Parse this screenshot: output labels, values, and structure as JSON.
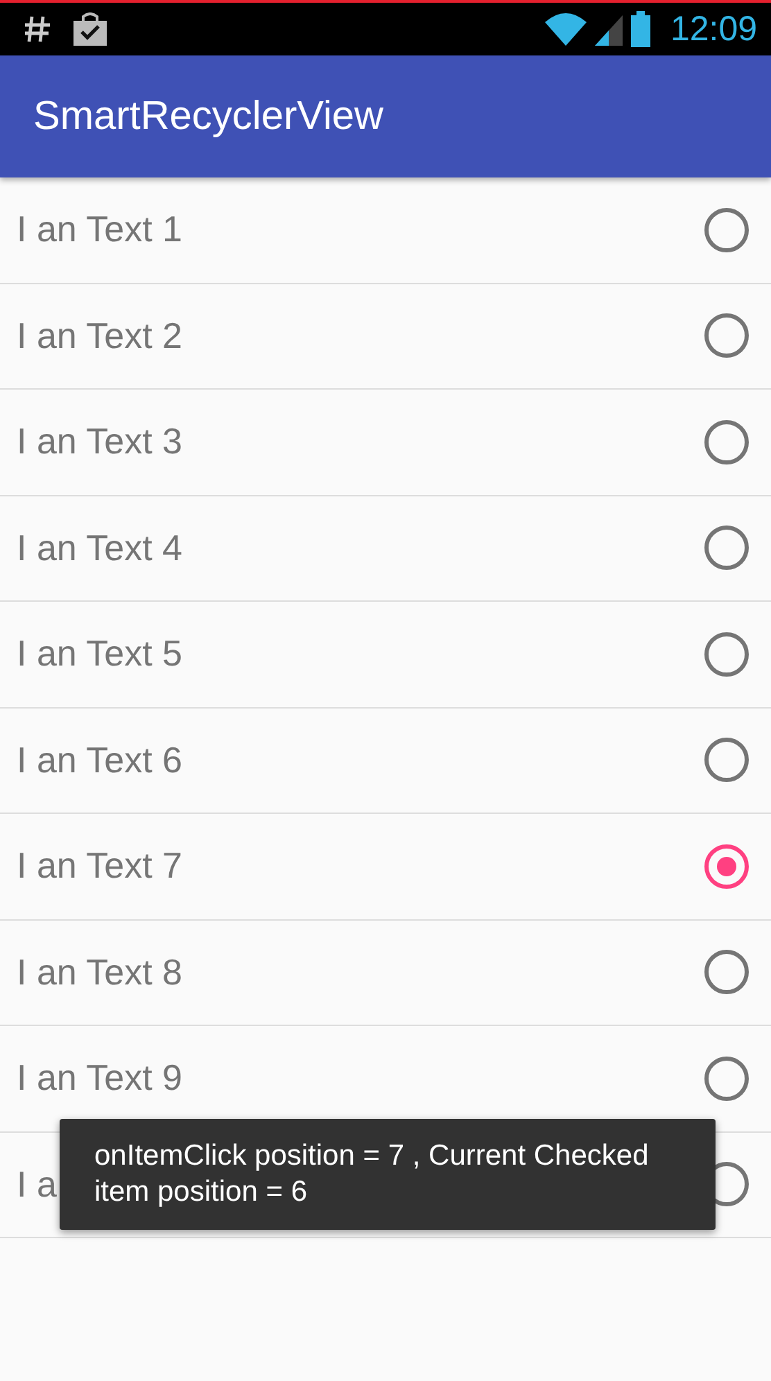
{
  "status_bar": {
    "time": "12:09"
  },
  "app_bar": {
    "title": "SmartRecyclerView"
  },
  "list": [
    {
      "text": "I an Text 1",
      "selected": false
    },
    {
      "text": "I an Text 2",
      "selected": false
    },
    {
      "text": "I an Text 3",
      "selected": false
    },
    {
      "text": "I an Text 4",
      "selected": false
    },
    {
      "text": "I an Text 5",
      "selected": false
    },
    {
      "text": "I an Text 6",
      "selected": false
    },
    {
      "text": "I an Text 7",
      "selected": true
    },
    {
      "text": "I an Text 8",
      "selected": false
    },
    {
      "text": "I an Text 9",
      "selected": false
    },
    {
      "text": "I a",
      "selected": false
    }
  ],
  "toast": {
    "message": "onItemClick position = 7 , Current Checked item position = 6"
  }
}
